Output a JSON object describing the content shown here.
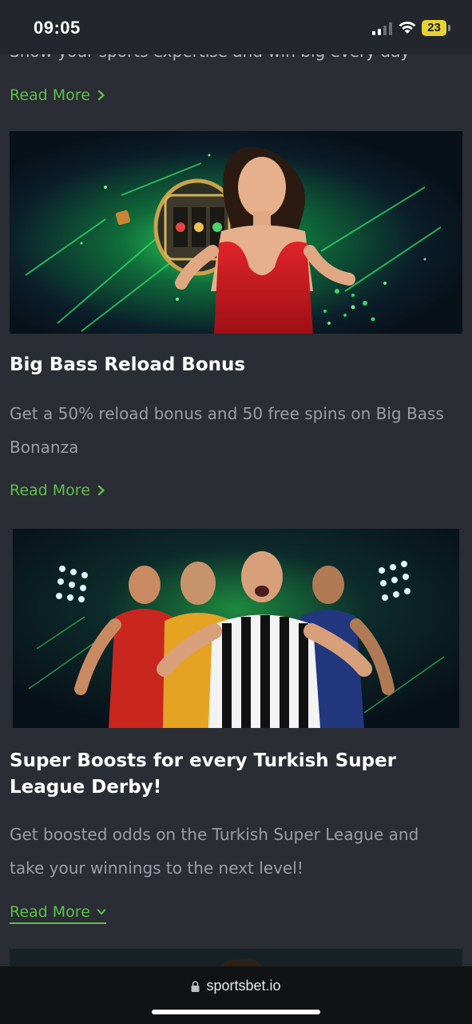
{
  "status_bar": {
    "time": "09:05",
    "battery": "23"
  },
  "top_snippet": {
    "text": "Show your sports expertise and win big every day",
    "read_more": "Read More"
  },
  "promos": [
    {
      "title": "Big Bass Reload Bonus",
      "description": "Get a 50% reload bonus and 50 free spins on Big Bass Bonanza",
      "read_more": "Read More",
      "image": "woman-red-dress-slot-reel"
    },
    {
      "title": "Super Boosts for every Turkish Super League Derby!",
      "description": "Get boosted odds on the Turkish Super League and take your winnings to the next level!",
      "read_more": "Read More",
      "image": "football-players-celebrating"
    }
  ],
  "browser": {
    "url": "sportsbet.io"
  },
  "colors": {
    "accent": "#5fbf4a",
    "background": "#2a2d34"
  }
}
